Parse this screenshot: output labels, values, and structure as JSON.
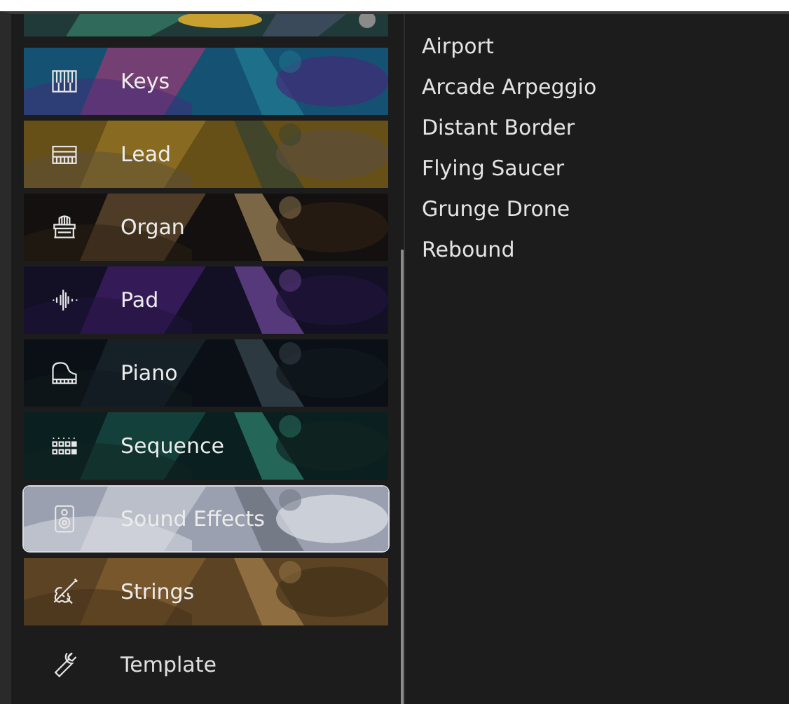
{
  "categories": [
    {
      "label": "Keys",
      "selected": false,
      "kind": "picture"
    },
    {
      "label": "Lead",
      "selected": false,
      "kind": "picture"
    },
    {
      "label": "Organ",
      "selected": false,
      "kind": "picture"
    },
    {
      "label": "Pad",
      "selected": false,
      "kind": "picture"
    },
    {
      "label": "Piano",
      "selected": false,
      "kind": "picture"
    },
    {
      "label": "Sequence",
      "selected": false,
      "kind": "picture"
    },
    {
      "label": "Sound Effects",
      "selected": true,
      "kind": "picture"
    },
    {
      "label": "Strings",
      "selected": false,
      "kind": "picture"
    },
    {
      "label": "Template",
      "selected": false,
      "kind": "plain"
    }
  ],
  "presets": [
    "Airport",
    "Arcade Arpeggio",
    "Distant Border",
    "Flying Saucer",
    "Grunge Drone",
    "Rebound"
  ]
}
